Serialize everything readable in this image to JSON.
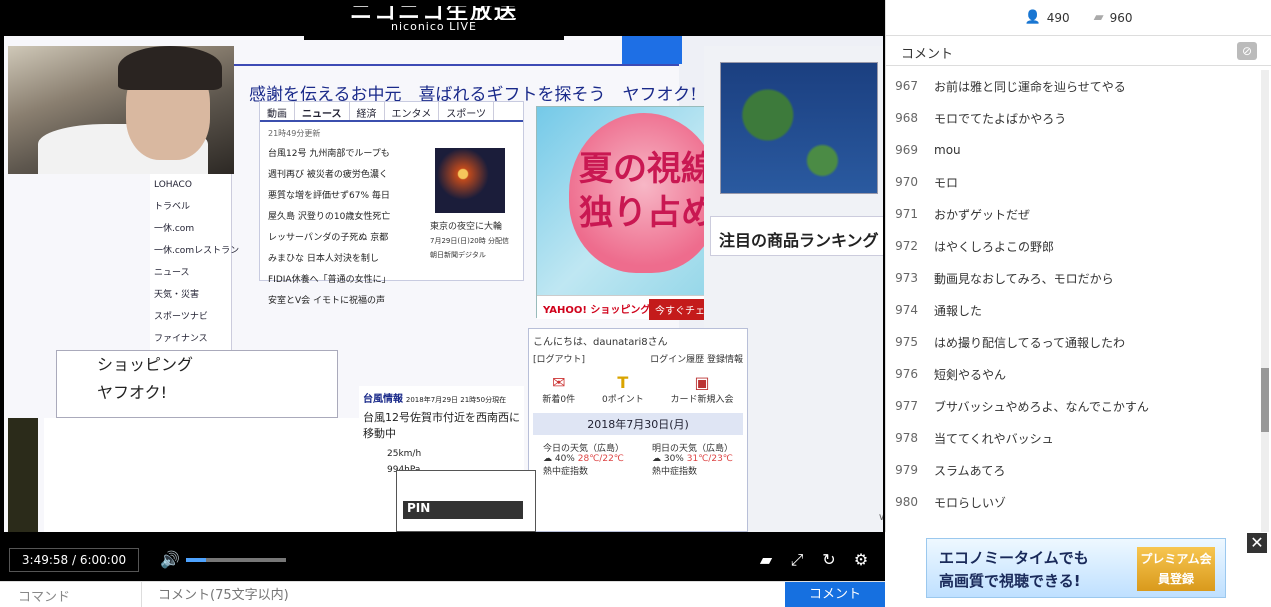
{
  "logo": {
    "top": "ニコニコ生放送",
    "bottom": "niconico LIVE"
  },
  "video": {
    "headline": "感謝を伝えるお中元　喜ばれるギフトを探そう　ヤフオク!",
    "news_tabs": [
      "動画",
      "ニュース",
      "経済",
      "エンタメ",
      "スポーツ"
    ],
    "news_updated": "21時49分更新",
    "news_items": [
      "台風12号 九州南部でループも",
      "週刊再び 被災者の疲労色濃く",
      "悪質な増を評価せず67% 毎日",
      "屋久島 沢登りの10歳女性死亡",
      "レッサーパンダの子死ぬ 京都",
      "みまひな 日本人対決を制し",
      "FIDIA休養へ「普通の女性に」",
      "安室とV会 イモトに祝福の声"
    ],
    "news_caption": [
      "東京の夜空に大輪",
      "7月29日(日)20時 分配信",
      "朝日新聞デジタル"
    ],
    "promo_text": [
      "夏の視線",
      "独り占め"
    ],
    "promo_logo": "YAHOO! ショッピング",
    "promo_btn": "今すぐチェック",
    "ranking": "注目の商品ランキング",
    "side_menu": [
      "LOHACO",
      "トラベル",
      "一休.com",
      "一休.comレストラン",
      "ニュース",
      "天気・災害",
      "スポーツナビ",
      "ファイナンス"
    ],
    "menu2": [
      "ショッピング",
      "ヤフオク!"
    ],
    "typhoon_title": "台風情報",
    "typhoon_time": "2018年7月29日 21時50分現在",
    "typhoon_desc": "台風12号佐賀市付近を西南西に移動中",
    "typhoon_wind": "25km/h",
    "typhoon_pressure": "994hPa",
    "login_hello": "こんにちは、daunatari8さん",
    "login_logout": "[ログアウト]",
    "login_history": "ログイン履歴",
    "login_info": "登録情報",
    "login_icons": [
      "新着0件",
      "0ポイント",
      "カード新規入会"
    ],
    "date": "2018年7月30日(月)",
    "weather_today": "今日の天気（広島）",
    "weather_tomorrow": "明日の天気（広島）",
    "weather_today_rain": "40%",
    "weather_today_temp": "28℃/22℃",
    "weather_tomorrow_rain": "30%",
    "weather_tomorrow_temp": "31℃/23℃",
    "heat_label": "熱中症指数"
  },
  "controls": {
    "time": "3:49:58 / 6:00:00",
    "volume_fraction": 0.2,
    "icons": [
      "comment-toggle-icon",
      "fullscreen-icon",
      "reload-icon",
      "settings-icon"
    ]
  },
  "comment_bar": {
    "command_placeholder": "コマンド",
    "comment_placeholder": "コメント(75文字以内)",
    "submit_label": "コメント"
  },
  "sidebar": {
    "viewers": "490",
    "comments_count": "960",
    "header": "コメント",
    "comments": [
      {
        "num": "967",
        "text": "お前は雅と同じ運命を辿らせてやる"
      },
      {
        "num": "968",
        "text": "モロでてたよばかやろう"
      },
      {
        "num": "969",
        "text": "mou"
      },
      {
        "num": "970",
        "text": "モロ"
      },
      {
        "num": "971",
        "text": "おかずゲットだぜ"
      },
      {
        "num": "972",
        "text": "はやくしろよこの野郎"
      },
      {
        "num": "973",
        "text": "動画見なおしてみろ、モロだから"
      },
      {
        "num": "974",
        "text": "通報した"
      },
      {
        "num": "975",
        "text": "はめ撮り配信してるって通報したわ"
      },
      {
        "num": "976",
        "text": "短剣やるやん"
      },
      {
        "num": "977",
        "text": "ブサバッシュやめろよ、なんでこかすん"
      },
      {
        "num": "978",
        "text": "当ててくれやバッシュ"
      },
      {
        "num": "979",
        "text": "スラムあてろ"
      },
      {
        "num": "980",
        "text": "モロらしいゾ"
      }
    ]
  },
  "ad": {
    "line1": "エコノミータイムでも",
    "line2": "高画質で視聴できる!",
    "button": "プレミアム会員登録",
    "close": "✕"
  }
}
